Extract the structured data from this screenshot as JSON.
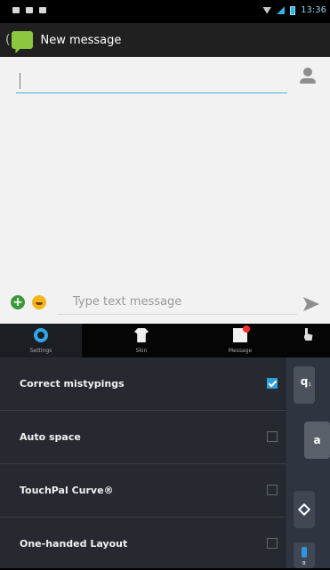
{
  "statusbar": {
    "time": "13:36"
  },
  "actionbar": {
    "back": "(",
    "title": "New message"
  },
  "compose": {
    "recipient_value": "",
    "message_placeholder": "Type text message"
  },
  "keyboard": {
    "tabs": [
      {
        "label": "Settings"
      },
      {
        "label": "Skin"
      },
      {
        "label": "Message"
      },
      {
        "label": ""
      }
    ],
    "settings": [
      {
        "label": "Correct mistypings"
      },
      {
        "label": "Auto space"
      },
      {
        "label": "TouchPal Curve®"
      },
      {
        "label": "One-handed Layout"
      }
    ],
    "keys": {
      "q": "q",
      "q_num": "1",
      "a": "a",
      "onehand_sub": "0"
    }
  },
  "colors": {
    "accent": "#31a6e8",
    "checked": "#2c9fdc",
    "appicon": "#8cc63f"
  }
}
